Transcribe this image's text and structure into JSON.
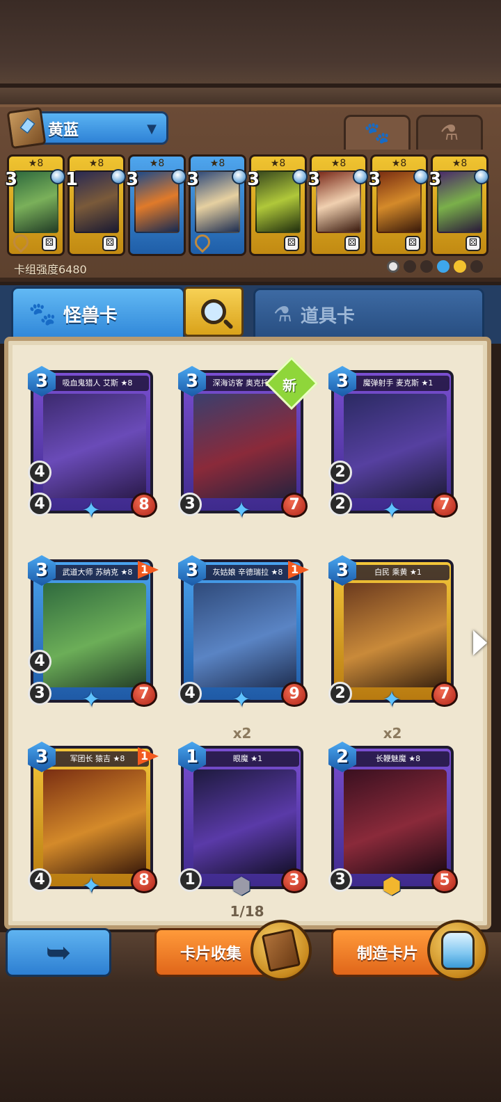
{
  "deck": {
    "name": "黄蓝",
    "power_label": "卡组强度6480",
    "cards": [
      {
        "star": "★8",
        "cost": "3",
        "color": "gold"
      },
      {
        "star": "★8",
        "cost": "1",
        "color": "gold"
      },
      {
        "star": "★8",
        "cost": "3",
        "color": "blue"
      },
      {
        "star": "★8",
        "cost": "3",
        "color": "blue"
      },
      {
        "star": "★8",
        "cost": "3",
        "color": "gold"
      },
      {
        "star": "★8",
        "cost": "3",
        "color": "gold"
      },
      {
        "star": "★8",
        "cost": "3",
        "color": "gold"
      },
      {
        "star": "★8",
        "cost": "3",
        "color": "gold"
      }
    ]
  },
  "top_tabs": {
    "monster_icon": "paw-icon",
    "item_icon": "flask-icon"
  },
  "tabs": {
    "monster_label": "怪兽卡",
    "item_label": "道具卡"
  },
  "cards": [
    {
      "name": "吸血鬼猎人 艾斯 ★8",
      "cost": "3",
      "atk": "4",
      "mov": "4",
      "hp": "8",
      "count": ""
    },
    {
      "name": "深海访客 奥克托 ★1",
      "cost": "3",
      "atk": "",
      "mov": "3",
      "hp": "7",
      "new": "新",
      "count": ""
    },
    {
      "name": "魔弹射手 麦克斯 ★1",
      "cost": "3",
      "atk": "2",
      "mov": "2",
      "hp": "7",
      "count": ""
    },
    {
      "name": "武道大师 苏纳克 ★8",
      "cost": "3",
      "atk": "4",
      "mov": "3",
      "hp": "7",
      "flag": "1",
      "count": ""
    },
    {
      "name": "灰姑娘 辛德瑞拉 ★8",
      "cost": "3",
      "atk": "",
      "mov": "4",
      "hp": "9",
      "flag": "1",
      "count": ""
    },
    {
      "name": "白民 乘黄 ★1",
      "cost": "3",
      "atk": "",
      "mov": "2",
      "hp": "7",
      "count": ""
    },
    {
      "name": "军团长 猿吉 ★8",
      "cost": "3",
      "atk": "",
      "mov": "4",
      "hp": "8",
      "flag": "1",
      "count": ""
    },
    {
      "name": "眼魔 ★1",
      "cost": "1",
      "atk": "",
      "mov": "1",
      "hp": "3",
      "count": "x2"
    },
    {
      "name": "长鞭魅魔 ★8",
      "cost": "2",
      "atk": "",
      "mov": "3",
      "hp": "5",
      "count": "x2"
    }
  ],
  "pagination": "1/18",
  "buttons": {
    "collect_label": "卡片收集",
    "craft_label": "制造卡片",
    "back_icon": "back-arrow-icon"
  }
}
